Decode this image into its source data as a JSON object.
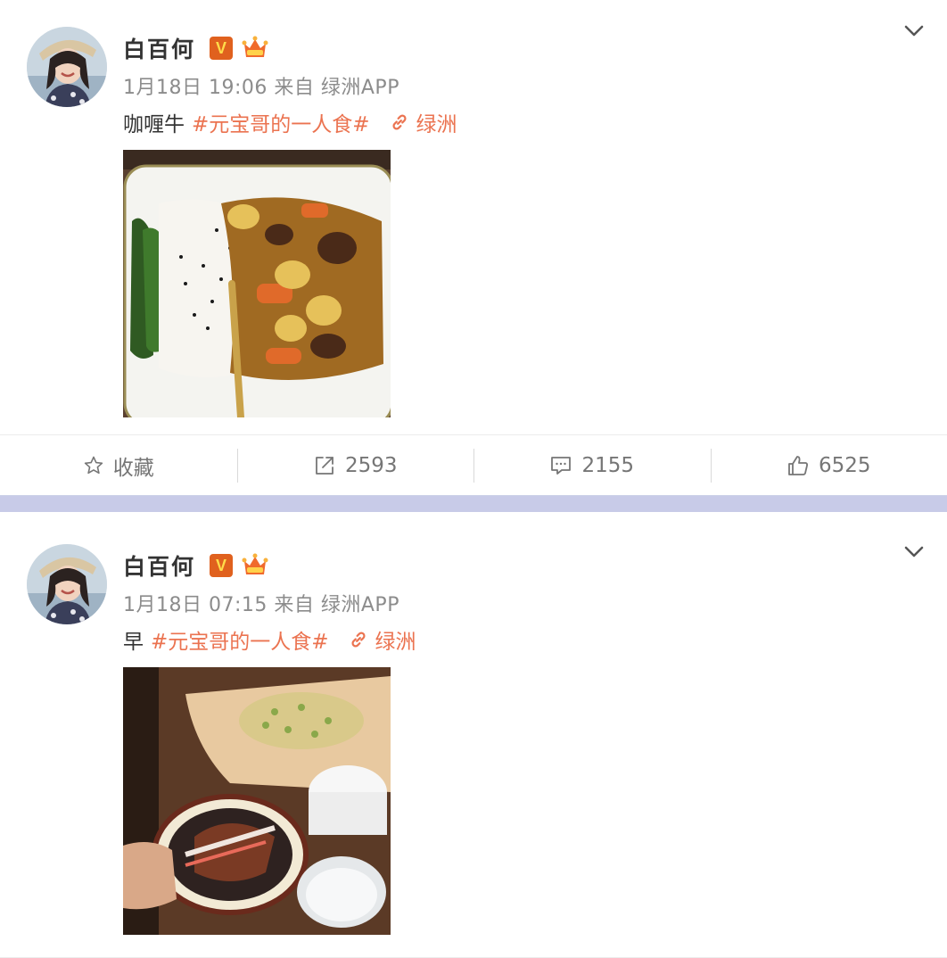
{
  "posts": [
    {
      "user": {
        "name": "白百何",
        "verified_badge": "V",
        "badge_colors": {
          "verified": "#e0611e",
          "crown": "#f06a2c"
        }
      },
      "meta": "1月18日 19:06 来自 绿洲APP",
      "content": {
        "text": "咖喱牛",
        "topic": "#元宝哥的一人食#",
        "location": "绿洲"
      },
      "image": {
        "description_icon": "curry-beef-photo"
      },
      "actions": {
        "favorite": "收藏",
        "repost": "2593",
        "comment": "2155",
        "like": "6525"
      }
    },
    {
      "user": {
        "name": "白百何",
        "verified_badge": "V"
      },
      "meta": "1月18日 07:15 来自 绿洲APP",
      "content": {
        "text": "早",
        "topic": "#元宝哥的一人食#",
        "location": "绿洲"
      },
      "image": {
        "description_icon": "breakfast-photo"
      }
    }
  ],
  "colors": {
    "link": "#eb7350",
    "meta": "#8c8c8c",
    "separator": "#c8cbe8"
  }
}
